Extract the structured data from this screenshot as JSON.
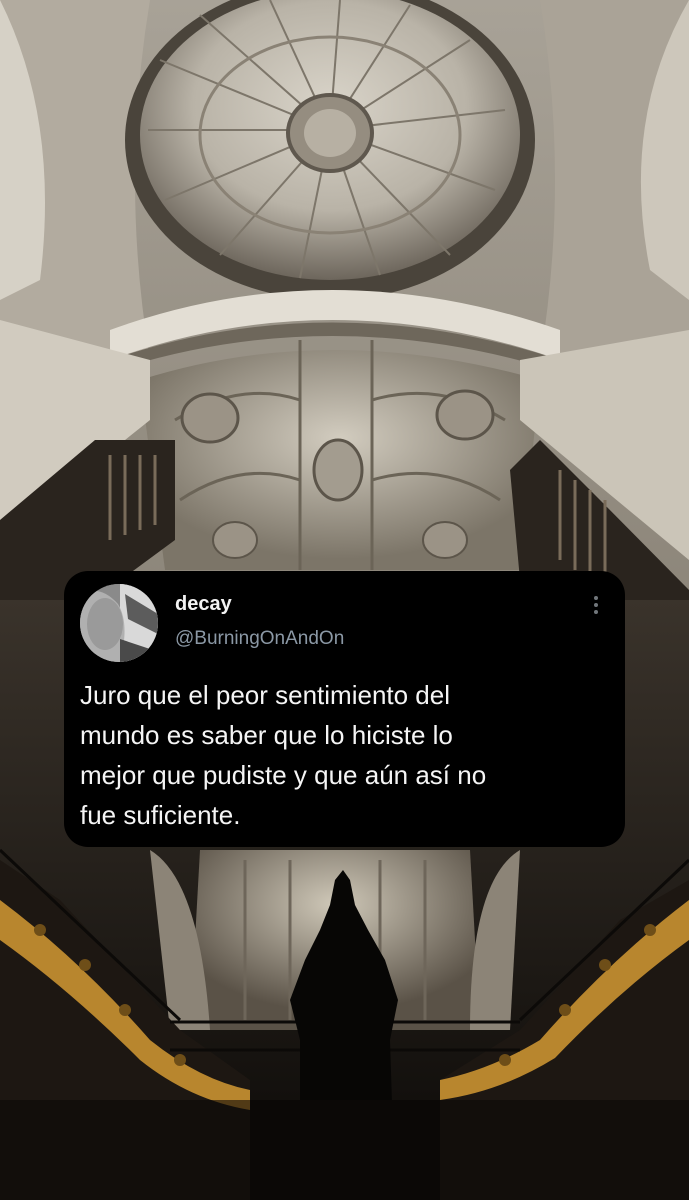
{
  "tweet": {
    "display_name": "decay",
    "handle": "@BurningOnAndOn",
    "text": "Juro que el peor sentimiento del\nmundo es saber que lo hiciste lo\nmejor que pudiste y que aún así no\nfue suficiente.",
    "avatar_icon": "user-avatar-photo",
    "more_icon": "more-options-icon"
  },
  "background": {
    "subject": "cathedral-dome-interior-photo",
    "colors": {
      "stone": "#cfc9bd",
      "shadow": "#1a1612",
      "gold": "#b8862e"
    }
  }
}
